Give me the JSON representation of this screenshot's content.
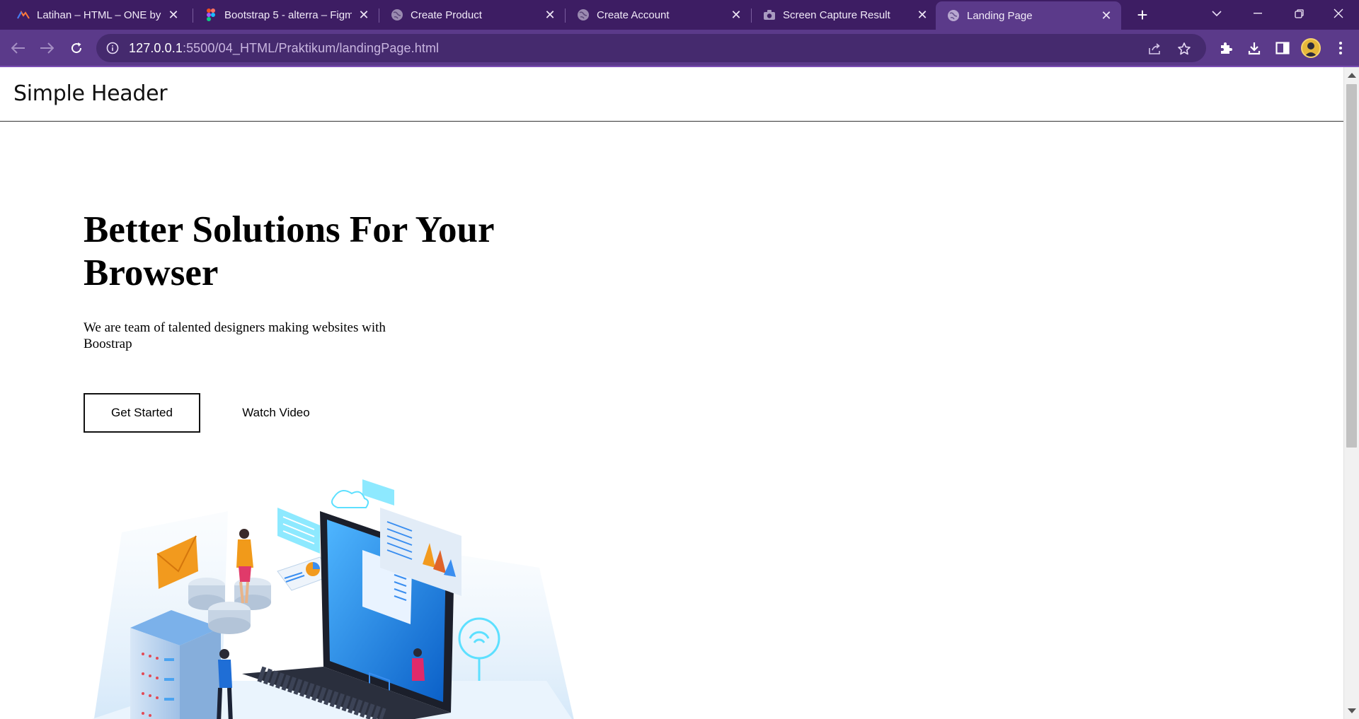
{
  "browser": {
    "tabs": [
      {
        "title": "Latihan – HTML – ONE by A",
        "icon": "alterra-icon",
        "active": false
      },
      {
        "title": "Bootstrap 5 - alterra – Figm",
        "icon": "figma-icon",
        "active": false
      },
      {
        "title": "Create Product",
        "icon": "globe-icon",
        "active": false
      },
      {
        "title": "Create Account",
        "icon": "globe-icon",
        "active": false
      },
      {
        "title": "Screen Capture Result",
        "icon": "camera-icon",
        "active": false
      },
      {
        "title": "Landing Page",
        "icon": "globe-icon",
        "active": true
      }
    ],
    "new_tab": "+",
    "address": {
      "host": "127.0.0.1",
      "path": ":5500/04_HTML/Praktikum/landingPage.html"
    },
    "colors": {
      "tabstrip": "#3d1d63",
      "toolbar": "#5b3a8a",
      "omnibox": "#452a6e"
    }
  },
  "site": {
    "header_title": "Simple Header",
    "hero": {
      "title": "Better Solutions For Your Browser",
      "subtitle": "We are team of talented designers making websites with Boostrap",
      "primary_button": "Get Started",
      "secondary_button": "Watch Video"
    }
  }
}
